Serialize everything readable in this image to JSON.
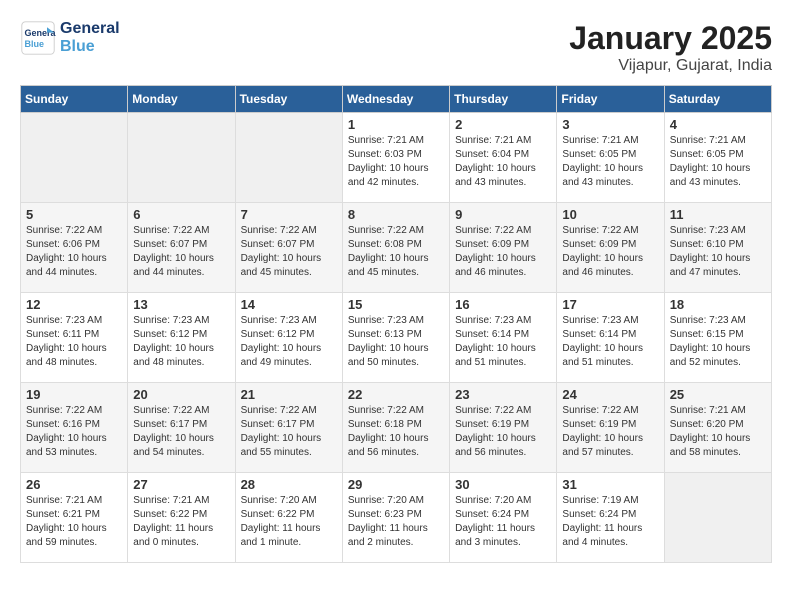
{
  "header": {
    "logo_line1": "General",
    "logo_line2": "Blue",
    "month": "January 2025",
    "location": "Vijapur, Gujarat, India"
  },
  "weekdays": [
    "Sunday",
    "Monday",
    "Tuesday",
    "Wednesday",
    "Thursday",
    "Friday",
    "Saturday"
  ],
  "weeks": [
    [
      {
        "day": "",
        "info": ""
      },
      {
        "day": "",
        "info": ""
      },
      {
        "day": "",
        "info": ""
      },
      {
        "day": "1",
        "info": "Sunrise: 7:21 AM\nSunset: 6:03 PM\nDaylight: 10 hours\nand 42 minutes."
      },
      {
        "day": "2",
        "info": "Sunrise: 7:21 AM\nSunset: 6:04 PM\nDaylight: 10 hours\nand 43 minutes."
      },
      {
        "day": "3",
        "info": "Sunrise: 7:21 AM\nSunset: 6:05 PM\nDaylight: 10 hours\nand 43 minutes."
      },
      {
        "day": "4",
        "info": "Sunrise: 7:21 AM\nSunset: 6:05 PM\nDaylight: 10 hours\nand 43 minutes."
      }
    ],
    [
      {
        "day": "5",
        "info": "Sunrise: 7:22 AM\nSunset: 6:06 PM\nDaylight: 10 hours\nand 44 minutes."
      },
      {
        "day": "6",
        "info": "Sunrise: 7:22 AM\nSunset: 6:07 PM\nDaylight: 10 hours\nand 44 minutes."
      },
      {
        "day": "7",
        "info": "Sunrise: 7:22 AM\nSunset: 6:07 PM\nDaylight: 10 hours\nand 45 minutes."
      },
      {
        "day": "8",
        "info": "Sunrise: 7:22 AM\nSunset: 6:08 PM\nDaylight: 10 hours\nand 45 minutes."
      },
      {
        "day": "9",
        "info": "Sunrise: 7:22 AM\nSunset: 6:09 PM\nDaylight: 10 hours\nand 46 minutes."
      },
      {
        "day": "10",
        "info": "Sunrise: 7:22 AM\nSunset: 6:09 PM\nDaylight: 10 hours\nand 46 minutes."
      },
      {
        "day": "11",
        "info": "Sunrise: 7:23 AM\nSunset: 6:10 PM\nDaylight: 10 hours\nand 47 minutes."
      }
    ],
    [
      {
        "day": "12",
        "info": "Sunrise: 7:23 AM\nSunset: 6:11 PM\nDaylight: 10 hours\nand 48 minutes."
      },
      {
        "day": "13",
        "info": "Sunrise: 7:23 AM\nSunset: 6:12 PM\nDaylight: 10 hours\nand 48 minutes."
      },
      {
        "day": "14",
        "info": "Sunrise: 7:23 AM\nSunset: 6:12 PM\nDaylight: 10 hours\nand 49 minutes."
      },
      {
        "day": "15",
        "info": "Sunrise: 7:23 AM\nSunset: 6:13 PM\nDaylight: 10 hours\nand 50 minutes."
      },
      {
        "day": "16",
        "info": "Sunrise: 7:23 AM\nSunset: 6:14 PM\nDaylight: 10 hours\nand 51 minutes."
      },
      {
        "day": "17",
        "info": "Sunrise: 7:23 AM\nSunset: 6:14 PM\nDaylight: 10 hours\nand 51 minutes."
      },
      {
        "day": "18",
        "info": "Sunrise: 7:23 AM\nSunset: 6:15 PM\nDaylight: 10 hours\nand 52 minutes."
      }
    ],
    [
      {
        "day": "19",
        "info": "Sunrise: 7:22 AM\nSunset: 6:16 PM\nDaylight: 10 hours\nand 53 minutes."
      },
      {
        "day": "20",
        "info": "Sunrise: 7:22 AM\nSunset: 6:17 PM\nDaylight: 10 hours\nand 54 minutes."
      },
      {
        "day": "21",
        "info": "Sunrise: 7:22 AM\nSunset: 6:17 PM\nDaylight: 10 hours\nand 55 minutes."
      },
      {
        "day": "22",
        "info": "Sunrise: 7:22 AM\nSunset: 6:18 PM\nDaylight: 10 hours\nand 56 minutes."
      },
      {
        "day": "23",
        "info": "Sunrise: 7:22 AM\nSunset: 6:19 PM\nDaylight: 10 hours\nand 56 minutes."
      },
      {
        "day": "24",
        "info": "Sunrise: 7:22 AM\nSunset: 6:19 PM\nDaylight: 10 hours\nand 57 minutes."
      },
      {
        "day": "25",
        "info": "Sunrise: 7:21 AM\nSunset: 6:20 PM\nDaylight: 10 hours\nand 58 minutes."
      }
    ],
    [
      {
        "day": "26",
        "info": "Sunrise: 7:21 AM\nSunset: 6:21 PM\nDaylight: 10 hours\nand 59 minutes."
      },
      {
        "day": "27",
        "info": "Sunrise: 7:21 AM\nSunset: 6:22 PM\nDaylight: 11 hours\nand 0 minutes."
      },
      {
        "day": "28",
        "info": "Sunrise: 7:20 AM\nSunset: 6:22 PM\nDaylight: 11 hours\nand 1 minute."
      },
      {
        "day": "29",
        "info": "Sunrise: 7:20 AM\nSunset: 6:23 PM\nDaylight: 11 hours\nand 2 minutes."
      },
      {
        "day": "30",
        "info": "Sunrise: 7:20 AM\nSunset: 6:24 PM\nDaylight: 11 hours\nand 3 minutes."
      },
      {
        "day": "31",
        "info": "Sunrise: 7:19 AM\nSunset: 6:24 PM\nDaylight: 11 hours\nand 4 minutes."
      },
      {
        "day": "",
        "info": ""
      }
    ]
  ]
}
